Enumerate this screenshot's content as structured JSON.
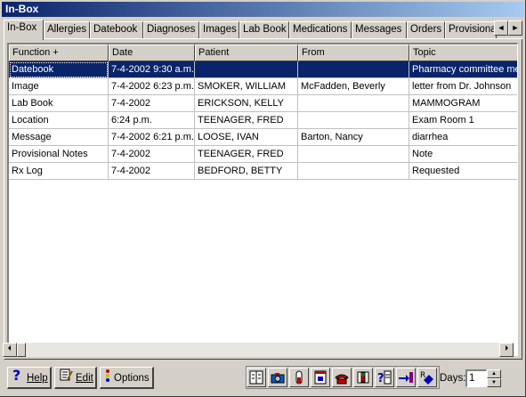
{
  "window": {
    "title": "In-Box"
  },
  "tabs": [
    {
      "label": "In-Box",
      "active": true
    },
    {
      "label": "Allergies"
    },
    {
      "label": "Datebook"
    },
    {
      "label": "Diagnoses"
    },
    {
      "label": "Images"
    },
    {
      "label": "Lab Book"
    },
    {
      "label": "Medications"
    },
    {
      "label": "Messages"
    },
    {
      "label": "Orders"
    },
    {
      "label": "Provisional"
    }
  ],
  "tab_scroll": {
    "left": "◄",
    "right": "►"
  },
  "table": {
    "columns": [
      "Function +",
      "Date",
      "Patient",
      "From",
      "Topic"
    ],
    "rows": [
      {
        "function": "Datebook",
        "date": "7-4-2002 9:30 a.m.",
        "patient": "",
        "from": "",
        "topic": "Pharmacy committee meeting",
        "selected": true
      },
      {
        "function": "Image",
        "date": "7-4-2002 6:23 p.m.",
        "patient": "SMOKER, WILLIAM",
        "from": "McFadden, Beverly",
        "topic": "letter from Dr. Johnson"
      },
      {
        "function": "Lab Book",
        "date": "7-4-2002",
        "patient": "ERICKSON, KELLY",
        "from": "",
        "topic": "MAMMOGRAM"
      },
      {
        "function": "Location",
        "date": "6:24 p.m.",
        "patient": "TEENAGER, FRED",
        "from": "",
        "topic": "Exam Room 1"
      },
      {
        "function": "Message",
        "date": "7-4-2002 6:21 p.m.",
        "patient": "LOOSE, IVAN",
        "from": "Barton, Nancy",
        "topic": "diarrhea"
      },
      {
        "function": "Provisional Notes",
        "date": "7-4-2002",
        "patient": "TEENAGER, FRED",
        "from": "",
        "topic": "Note"
      },
      {
        "function": "Rx Log",
        "date": "7-4-2002",
        "patient": "BEDFORD, BETTY",
        "from": "",
        "topic": "Requested"
      }
    ]
  },
  "scrollbar": {
    "left": "◄",
    "right": "►"
  },
  "toolbar": {
    "help_label": "Help",
    "edit_label": "Edit",
    "options_label": "Options",
    "icons": [
      "datebook-icon",
      "camera-icon",
      "test-tube-icon",
      "calendar-page-icon",
      "telephone-icon",
      "vial-icon",
      "help-book-icon",
      "transfer-icon",
      "prescription-icon"
    ],
    "days_label": "Days:",
    "days_value": "1"
  }
}
